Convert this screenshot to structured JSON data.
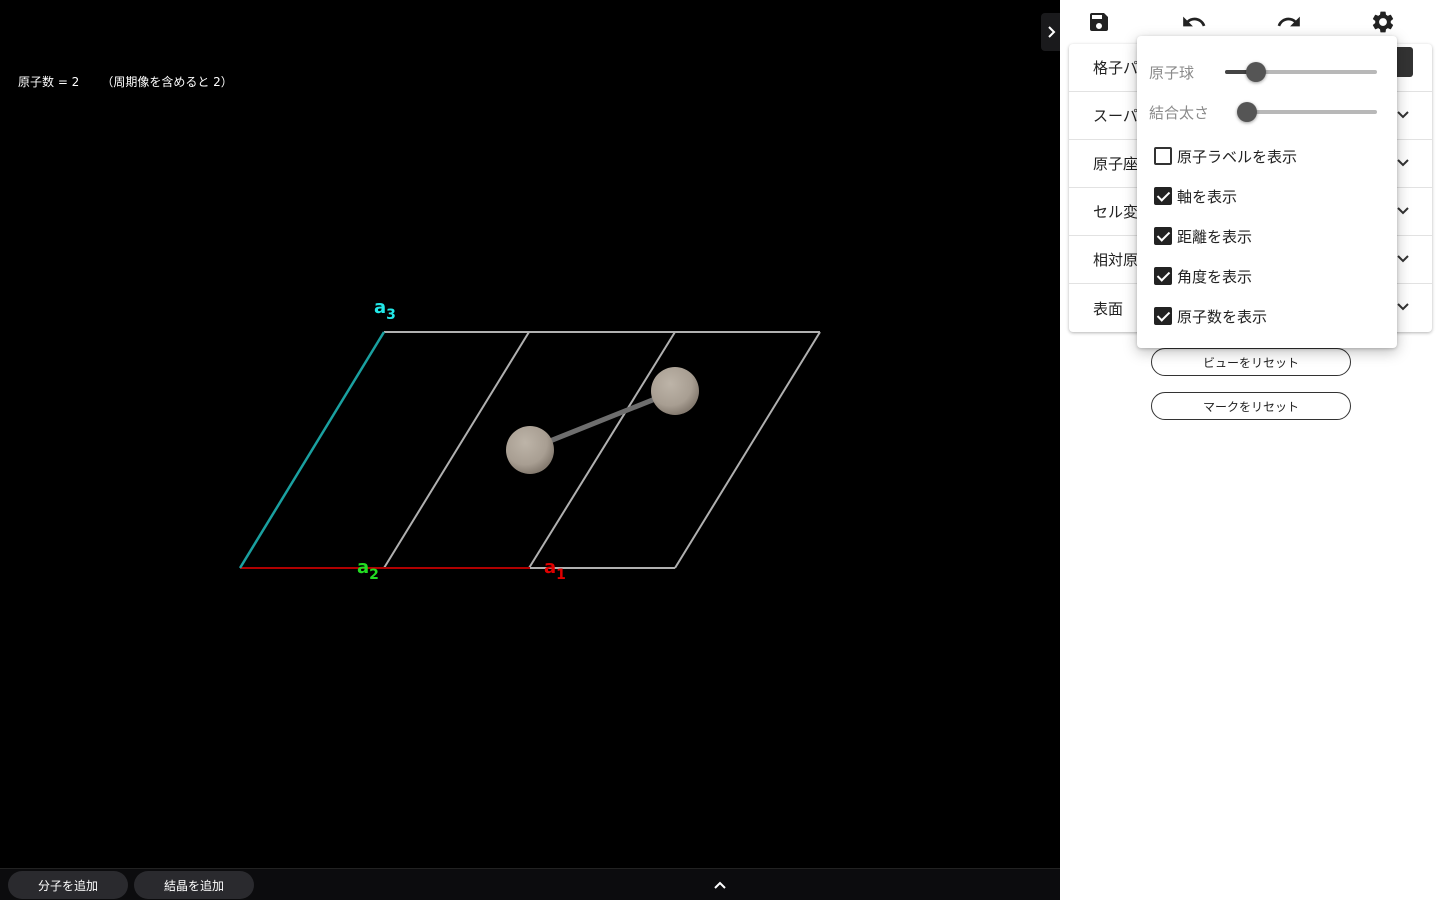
{
  "viewer": {
    "atom_count": "原子数 = 2",
    "periodic_count": "（周期像を含めると 2）",
    "axis_labels": {
      "a1": {
        "letter": "a",
        "sub": "1",
        "color": "#e00000"
      },
      "a2": {
        "letter": "a",
        "sub": "2",
        "color": "#22dd22"
      },
      "a3": {
        "letter": "a",
        "sub": "3",
        "color": "#22e8e8"
      }
    },
    "colors": {
      "background": "#000000",
      "cell_edge": "#b0b0b0",
      "a1_axis": "#b00000",
      "a3_axis": "#1aa0a0",
      "atom": "#a89e92",
      "bond": "#777777"
    }
  },
  "bottom_bar": {
    "add_molecule": "分子を追加",
    "add_crystal": "結晶を追加",
    "expand_icon": "chevron-up-icon"
  },
  "toolbar": {
    "icons": [
      "save-icon",
      "undo-icon",
      "redo-icon",
      "gear-icon"
    ]
  },
  "accordion": {
    "items": [
      {
        "label": "格子パ"
      },
      {
        "label": "スーパ"
      },
      {
        "label": "原子座"
      },
      {
        "label": "セル変"
      },
      {
        "label": "相対原"
      },
      {
        "label": "表面"
      }
    ]
  },
  "buttons": {
    "reset_view": "ビューをリセット",
    "reset_mark": "マークをリセット"
  },
  "settings": {
    "atom_ball_label": "原子球",
    "atom_ball_value": 0.2,
    "bond_width_label": "結合太さ",
    "bond_width_value": 0.0,
    "checks": [
      {
        "label": "原子ラベルを表示",
        "checked": false
      },
      {
        "label": "軸を表示",
        "checked": true
      },
      {
        "label": "距離を表示",
        "checked": true
      },
      {
        "label": "角度を表示",
        "checked": true
      },
      {
        "label": "原子数を表示",
        "checked": true
      }
    ]
  }
}
